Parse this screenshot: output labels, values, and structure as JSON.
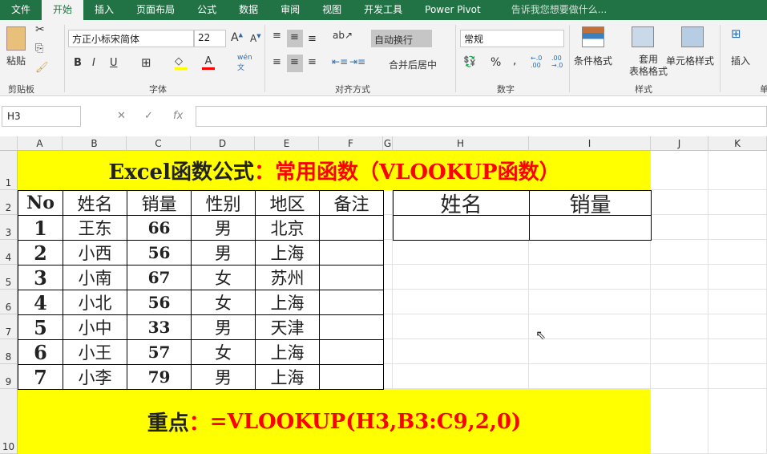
{
  "tabs": [
    "文件",
    "开始",
    "插入",
    "页面布局",
    "公式",
    "数据",
    "审阅",
    "视图",
    "开发工具",
    "Power Pivot"
  ],
  "tell_me": "告诉我您想要做什么...",
  "ribbon": {
    "paste": "粘贴",
    "clipboard": "剪贴板",
    "font_name": "方正小标宋简体",
    "font_size": "22",
    "font_group": "字体",
    "wrap": "自动换行",
    "merge": "合并后居中",
    "align_group": "对齐方式",
    "number_format": "常规",
    "number_group": "数字",
    "cond_format": "条件格式",
    "table_format_1": "套用",
    "table_format_2": "表格格式",
    "cell_style": "单元格样式",
    "styles_group": "样式",
    "insert": "插入",
    "cells_group": "单"
  },
  "name_box": "H3",
  "formula": "",
  "columns": [
    "A",
    "B",
    "C",
    "D",
    "E",
    "F",
    "G",
    "H",
    "I",
    "J",
    "K"
  ],
  "rows": [
    "1",
    "2",
    "3",
    "4",
    "5",
    "6",
    "7",
    "8",
    "9",
    "10"
  ],
  "title": {
    "black": "Excel函数公式",
    "red": "：常用函数（VLOOKUP函数）"
  },
  "table": {
    "headers": [
      "No",
      "姓名",
      "销量",
      "性别",
      "地区",
      "备注"
    ],
    "rows": [
      [
        "1",
        "王东",
        "66",
        "男",
        "北京",
        ""
      ],
      [
        "2",
        "小西",
        "56",
        "男",
        "上海",
        ""
      ],
      [
        "3",
        "小南",
        "67",
        "女",
        "苏州",
        ""
      ],
      [
        "4",
        "小北",
        "56",
        "女",
        "上海",
        ""
      ],
      [
        "5",
        "小中",
        "33",
        "男",
        "天津",
        ""
      ],
      [
        "6",
        "小王",
        "57",
        "女",
        "上海",
        ""
      ],
      [
        "7",
        "小李",
        "79",
        "男",
        "上海",
        ""
      ]
    ]
  },
  "lookup": {
    "headers": [
      "姓名",
      "销量"
    ],
    "values": [
      "",
      ""
    ]
  },
  "note": {
    "black": "重点",
    "colon": "：",
    "formula": "=VLOOKUP(H3,B3:C9,2,0)"
  },
  "colors": {
    "ribbon_green": "#217346",
    "highlight": "#ffff00",
    "accent_red": "#ff0000"
  }
}
